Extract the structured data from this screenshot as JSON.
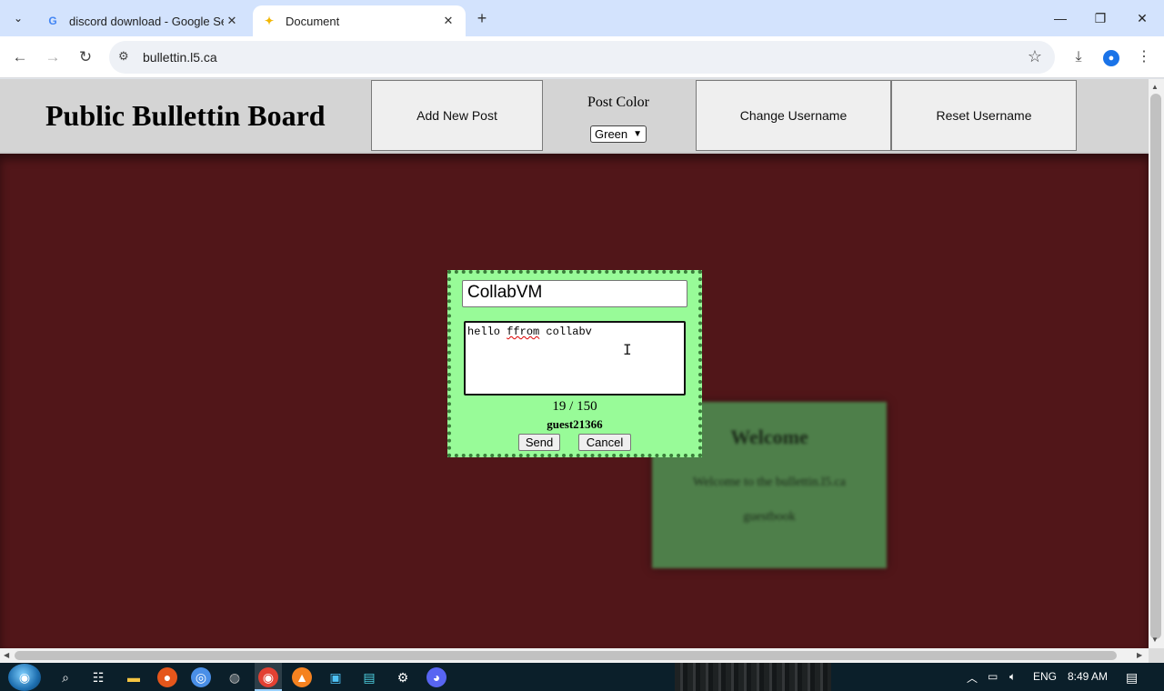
{
  "browser": {
    "tabs": [
      {
        "title": "discord download - Google Sea",
        "favicon": "google-g",
        "active": false
      },
      {
        "title": "Document",
        "favicon": "spark",
        "active": true
      }
    ],
    "url": "bullettin.l5.ca"
  },
  "page": {
    "title": "Public Bullettin Board",
    "add_post_label": "Add New Post",
    "post_color_label": "Post Color",
    "post_color_selected": "Green",
    "change_username_label": "Change Username",
    "reset_username_label": "Reset Username",
    "colors": {
      "header_bg": "#d4d4d4",
      "board_bg": "#511619",
      "modal_bg": "#98fb98",
      "post_bg": "#4e7f4a"
    }
  },
  "modal": {
    "title_value": "CollabVM",
    "body_value": "hello ffrom collabv",
    "body_misspelled_word": "ffrom",
    "char_count": "19 / 150",
    "username": "guest21366",
    "send_label": "Send",
    "cancel_label": "Cancel"
  },
  "post": {
    "title": "Welcome",
    "body_line1": "Welcome to the bullettin.l5.ca",
    "body_line2": "guestbook"
  },
  "taskbar": {
    "tray_lang": "ENG",
    "tray_time": "8:49 AM",
    "apps": [
      "search-icon",
      "task-view-icon",
      "file-explorer-icon",
      "firefox-icon",
      "chromium-icon",
      "steam-icon",
      "chrome-icon",
      "vlc-icon",
      "app-icon",
      "app-icon",
      "settings-icon",
      "discord-icon"
    ]
  }
}
